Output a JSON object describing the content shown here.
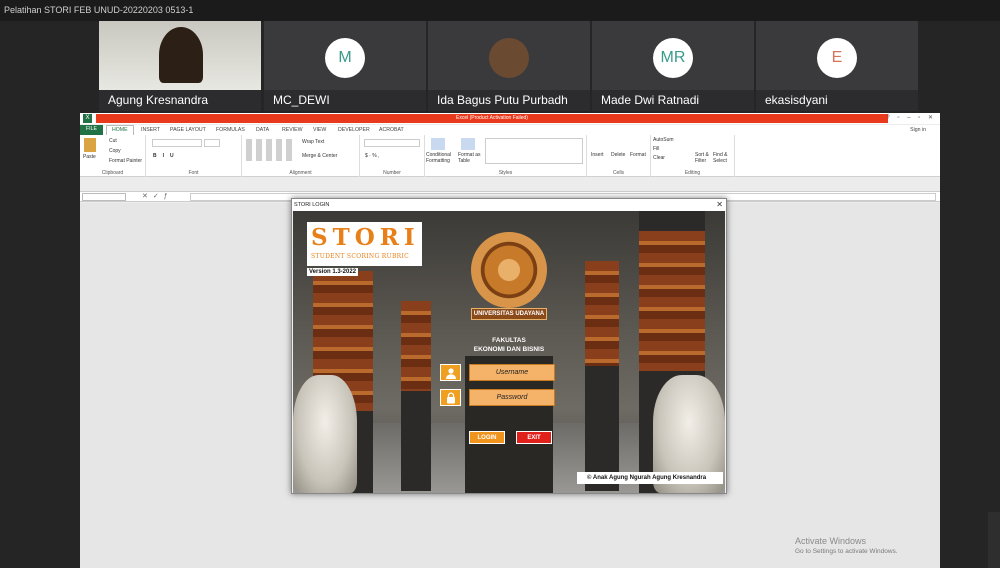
{
  "window": {
    "title": "Pelatihan STORI FEB UNUD-20220203 0513-1"
  },
  "participants": [
    {
      "name": "Agung Kresnandra",
      "initials": ""
    },
    {
      "name": "MC_DEWI",
      "initials": "M"
    },
    {
      "name": "Ida Bagus Putu Purbadh",
      "initials": ""
    },
    {
      "name": "Made Dwi Ratnadi",
      "initials": "MR"
    },
    {
      "name": "ekasisdyani",
      "initials": "E"
    }
  ],
  "excel": {
    "title": "Excel (Product Activation Failed)",
    "signin": "Sign in",
    "tabs": [
      "FILE",
      "HOME",
      "INSERT",
      "PAGE LAYOUT",
      "FORMULAS",
      "DATA",
      "REVIEW",
      "VIEW",
      "DEVELOPER",
      "ACROBAT"
    ],
    "ribbon": {
      "paste": "Paste",
      "cut": "Cut",
      "copy": "Copy",
      "format_painter": "Format Painter",
      "clipboard": "Clipboard",
      "font": "Font",
      "wrap_text": "Wrap Text",
      "merge_center": "Merge & Center",
      "alignment": "Alignment",
      "number": "Number",
      "conditional_formatting": "Conditional Formatting",
      "format_as_table": "Format as Table",
      "styles": "Styles",
      "insert": "Insert",
      "delete": "Delete",
      "format": "Format",
      "cells": "Cells",
      "autosum": "AutoSum",
      "fill": "Fill",
      "clear": "Clear",
      "sort_filter": "Sort & Filter",
      "find_select": "Find & Select",
      "editing": "Editing"
    }
  },
  "dialog": {
    "title": "STORI LOGIN",
    "logo_text": "STORI",
    "logo_sub": "STUDENT SCORING RUBRIC",
    "version": "Version 1.3-2022",
    "university": "UNIVERSITAS UDAYANA",
    "faculty_line1": "FAKULTAS",
    "faculty_line2": "EKONOMI DAN BISNIS",
    "username_placeholder": "Username",
    "password_placeholder": "Password",
    "login": "LOGIN",
    "exit": "EXIT",
    "copyright": "© Anak Agung Ngurah Agung Kresnandra"
  },
  "watermark": {
    "line1": "Activate Windows",
    "line2": "Go to Settings to activate Windows."
  },
  "colors": {
    "excel_green": "#217346",
    "accent_orange": "#f0a020",
    "exit_red": "#e0201a",
    "login_orange": "#f0941e"
  }
}
